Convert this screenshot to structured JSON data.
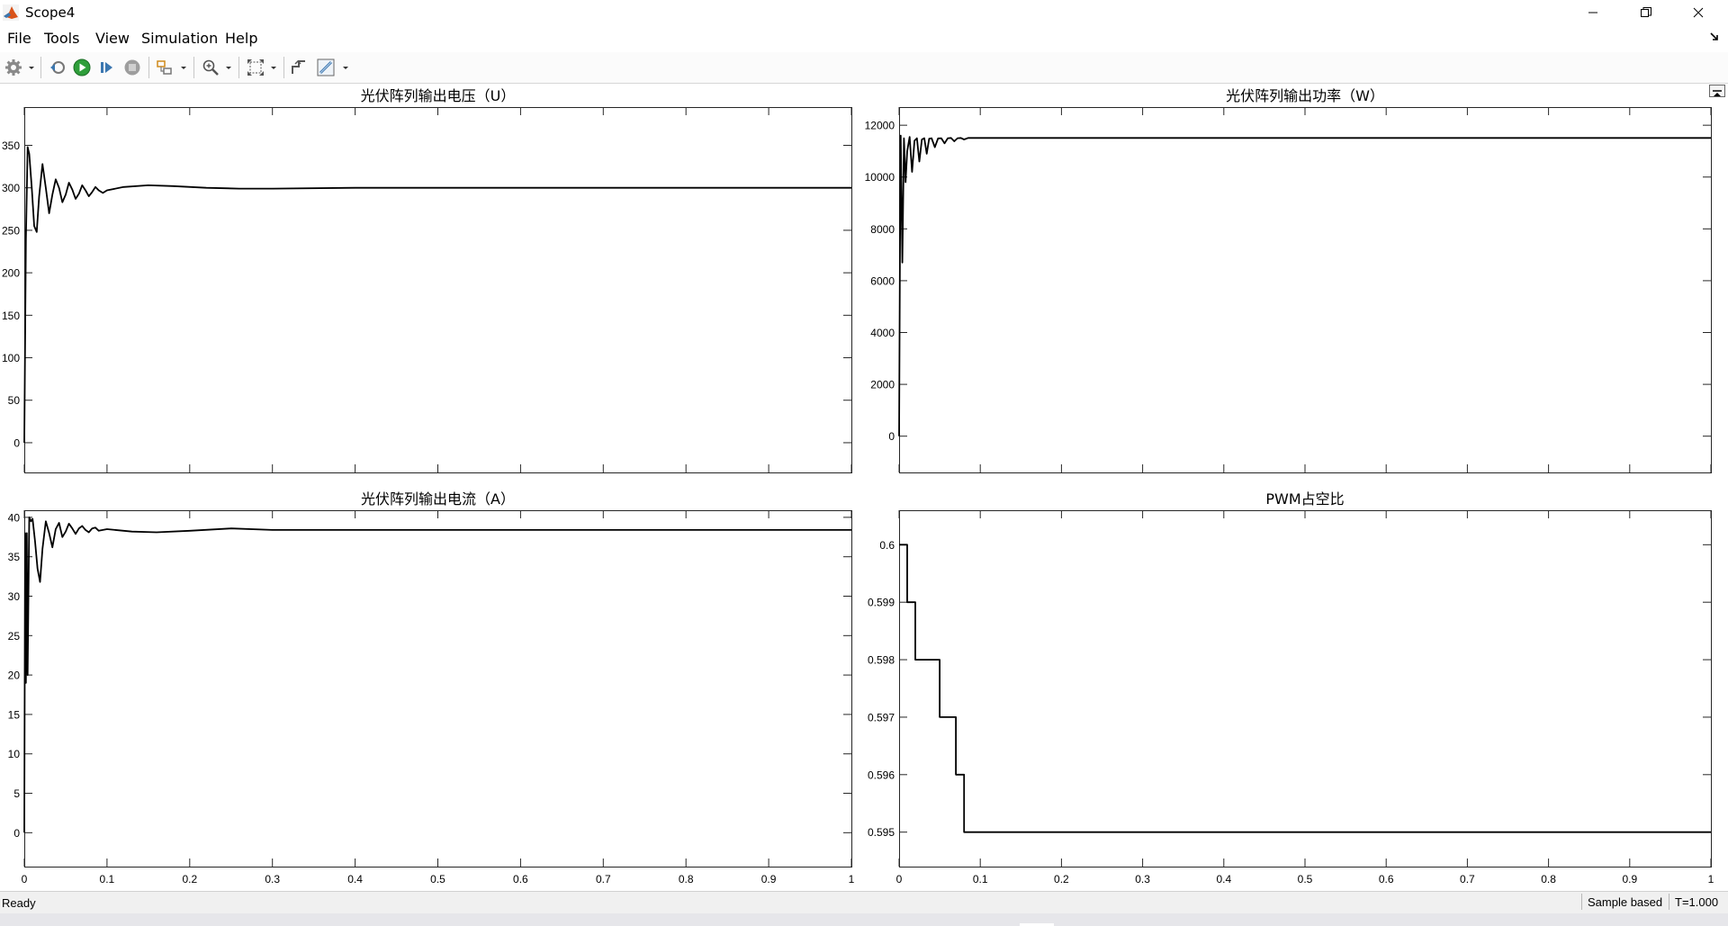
{
  "window": {
    "title": "Scope4"
  },
  "menu": {
    "items": [
      "File",
      "Tools",
      "View",
      "Simulation",
      "Help"
    ]
  },
  "status": {
    "left": "Ready",
    "mode": "Sample based",
    "time": "T=1.000"
  },
  "chart_data": [
    {
      "type": "line",
      "title": "光伏阵列输出电压（U）",
      "xlim": [
        0,
        1
      ],
      "ylim": [
        -35,
        395
      ],
      "yticks": [
        0,
        50,
        100,
        150,
        200,
        250,
        300,
        350
      ],
      "xticks": [
        0,
        0.1,
        0.2,
        0.3,
        0.4,
        0.5,
        0.6,
        0.7,
        0.8,
        0.9,
        1
      ],
      "show_xticklabels": false,
      "grid": false,
      "series": [
        {
          "x": [
            0,
            0.002,
            0.004,
            0.006,
            0.009,
            0.012,
            0.015,
            0.018,
            0.022,
            0.026,
            0.03,
            0.034,
            0.038,
            0.042,
            0.046,
            0.05,
            0.054,
            0.058,
            0.062,
            0.066,
            0.07,
            0.074,
            0.078,
            0.082,
            0.086,
            0.09,
            0.095,
            0.1,
            0.12,
            0.15,
            0.18,
            0.22,
            0.26,
            0.3,
            0.4,
            0.5,
            0.6,
            1.0
          ],
          "y": [
            0,
            240,
            348,
            340,
            300,
            255,
            248,
            290,
            328,
            300,
            270,
            292,
            310,
            300,
            283,
            292,
            306,
            298,
            287,
            293,
            303,
            297,
            290,
            295,
            301,
            297,
            294,
            297,
            301,
            303,
            302,
            300,
            299,
            299,
            300,
            300,
            300,
            300
          ]
        }
      ]
    },
    {
      "type": "line",
      "title": "光伏阵列输出功率（W）",
      "xlim": [
        0,
        1
      ],
      "ylim": [
        -1400,
        12700
      ],
      "yticks": [
        0,
        2000,
        4000,
        6000,
        8000,
        10000,
        12000
      ],
      "xticks": [
        0,
        0.1,
        0.2,
        0.3,
        0.4,
        0.5,
        0.6,
        0.7,
        0.8,
        0.9,
        1
      ],
      "show_xticklabels": false,
      "grid": false,
      "series": [
        {
          "x": [
            0,
            0.001,
            0.002,
            0.004,
            0.006,
            0.008,
            0.01,
            0.013,
            0.016,
            0.019,
            0.022,
            0.025,
            0.028,
            0.031,
            0.034,
            0.037,
            0.04,
            0.044,
            0.048,
            0.052,
            0.056,
            0.06,
            0.064,
            0.068,
            0.072,
            0.076,
            0.08,
            0.085,
            0.09,
            0.1,
            0.2,
            1.0
          ],
          "y": [
            0,
            6800,
            11600,
            6700,
            11500,
            9800,
            11000,
            11550,
            10200,
            11400,
            11500,
            10600,
            11450,
            11500,
            10900,
            11480,
            11500,
            11150,
            11490,
            11500,
            11300,
            11500,
            11510,
            11380,
            11500,
            11510,
            11450,
            11510,
            11510,
            11510,
            11510,
            11510
          ]
        }
      ]
    },
    {
      "type": "line",
      "title": "光伏阵列输出电流（A）",
      "xlim": [
        0,
        1
      ],
      "ylim": [
        -4.3,
        40.9
      ],
      "yticks": [
        0,
        5,
        10,
        15,
        20,
        25,
        30,
        35,
        40
      ],
      "xticks": [
        0,
        0.1,
        0.2,
        0.3,
        0.4,
        0.5,
        0.6,
        0.7,
        0.8,
        0.9,
        1
      ],
      "xticklabels": [
        "0",
        "0.1",
        "0.2",
        "0.3",
        "0.4",
        "0.5",
        "0.6",
        "0.7",
        "0.8",
        "0.9",
        "1"
      ],
      "grid": false,
      "series": [
        {
          "x": [
            0,
            0.001,
            0.002,
            0.003,
            0.004,
            0.006,
            0.008,
            0.01,
            0.013,
            0.016,
            0.019,
            0.022,
            0.026,
            0.03,
            0.034,
            0.038,
            0.042,
            0.046,
            0.05,
            0.054,
            0.058,
            0.062,
            0.066,
            0.07,
            0.074,
            0.078,
            0.082,
            0.086,
            0.09,
            0.095,
            0.1,
            0.13,
            0.16,
            0.2,
            0.25,
            0.3,
            0.4,
            1.0
          ],
          "y": [
            0,
            38,
            19,
            38,
            20,
            40,
            39.5,
            39.8,
            37,
            33.5,
            31.8,
            36,
            39.5,
            38,
            36.2,
            38.5,
            39.3,
            37.5,
            38.2,
            39.2,
            38.6,
            37.9,
            38.6,
            38.9,
            38.4,
            38.1,
            38.6,
            38.7,
            38.3,
            38.4,
            38.5,
            38.2,
            38.1,
            38.3,
            38.6,
            38.4,
            38.4,
            38.4
          ]
        }
      ]
    },
    {
      "type": "line",
      "title": "PWM占空比",
      "xlim": [
        0,
        1
      ],
      "ylim": [
        0.5944,
        0.6006
      ],
      "yticks": [
        0.595,
        0.596,
        0.597,
        0.598,
        0.599,
        0.6
      ],
      "yticklabels": [
        "0.595",
        "0.596",
        "0.597",
        "0.598",
        "0.599",
        "0.6"
      ],
      "xticks": [
        0,
        0.1,
        0.2,
        0.3,
        0.4,
        0.5,
        0.6,
        0.7,
        0.8,
        0.9,
        1
      ],
      "xticklabels": [
        "0",
        "0.1",
        "0.2",
        "0.3",
        "0.4",
        "0.5",
        "0.6",
        "0.7",
        "0.8",
        "0.9",
        "1"
      ],
      "grid": false,
      "series": [
        {
          "x": [
            0,
            0.01,
            0.01,
            0.02,
            0.02,
            0.05,
            0.05,
            0.07,
            0.07,
            0.08,
            0.08,
            1.0
          ],
          "y": [
            0.6,
            0.6,
            0.599,
            0.599,
            0.598,
            0.598,
            0.597,
            0.597,
            0.596,
            0.596,
            0.595,
            0.595
          ]
        }
      ]
    }
  ]
}
